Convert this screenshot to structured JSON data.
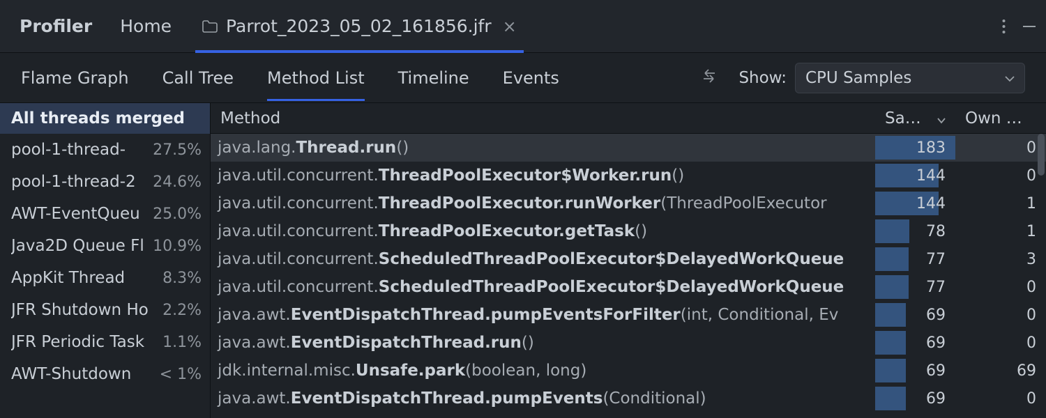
{
  "header": {
    "title": "Profiler",
    "home": "Home",
    "file_name": "Parrot_2023_05_02_161856.jfr"
  },
  "toolbar": {
    "tabs": [
      "Flame Graph",
      "Call Tree",
      "Method List",
      "Timeline",
      "Events"
    ],
    "active_tab": 2,
    "show_label": "Show:",
    "combo_value": "CPU Samples"
  },
  "sidebar": {
    "header": "All threads merged",
    "items": [
      {
        "name": "pool-1-thread-",
        "pct": "27.5%"
      },
      {
        "name": "pool-1-thread-2",
        "pct": "24.6%"
      },
      {
        "name": "AWT-EventQueu",
        "pct": "25.0%"
      },
      {
        "name": "Java2D Queue Fl",
        "pct": "10.9%"
      },
      {
        "name": "AppKit Thread",
        "pct": "8.3%"
      },
      {
        "name": "JFR Shutdown Ho",
        "pct": "2.2%"
      },
      {
        "name": "JFR Periodic Task",
        "pct": "1.1%"
      },
      {
        "name": "AWT-Shutdown",
        "pct": "< 1%"
      }
    ]
  },
  "table": {
    "columns": {
      "method": "Method",
      "samples": "Sa…",
      "own": "Own …"
    },
    "max_samples": 183,
    "rows": [
      {
        "pkg": "java.lang.",
        "sig": "Thread.run",
        "args": "()",
        "sa": 183,
        "own": 0,
        "selected": true
      },
      {
        "pkg": "java.util.concurrent.",
        "sig": "ThreadPoolExecutor$Worker.run",
        "args": "()",
        "sa": 144,
        "own": 0
      },
      {
        "pkg": "java.util.concurrent.",
        "sig": "ThreadPoolExecutor.runWorker",
        "args": "(ThreadPoolExecutor",
        "sa": 144,
        "own": 1
      },
      {
        "pkg": "java.util.concurrent.",
        "sig": "ThreadPoolExecutor.getTask",
        "args": "()",
        "sa": 78,
        "own": 1
      },
      {
        "pkg": "java.util.concurrent.",
        "sig": "ScheduledThreadPoolExecutor$DelayedWorkQueue",
        "args": "",
        "sa": 77,
        "own": 3
      },
      {
        "pkg": "java.util.concurrent.",
        "sig": "ScheduledThreadPoolExecutor$DelayedWorkQueue",
        "args": "",
        "sa": 77,
        "own": 0
      },
      {
        "pkg": "java.awt.",
        "sig": "EventDispatchThread.pumpEventsForFilter",
        "args": "(int, Conditional, Ev",
        "sa": 69,
        "own": 0
      },
      {
        "pkg": "java.awt.",
        "sig": "EventDispatchThread.run",
        "args": "()",
        "sa": 69,
        "own": 0
      },
      {
        "pkg": "jdk.internal.misc.",
        "sig": "Unsafe.park",
        "args": "(boolean, long)",
        "sa": 69,
        "own": 69
      },
      {
        "pkg": "java.awt.",
        "sig": "EventDispatchThread.pumpEvents",
        "args": "(Conditional)",
        "sa": 69,
        "own": 0
      }
    ]
  }
}
